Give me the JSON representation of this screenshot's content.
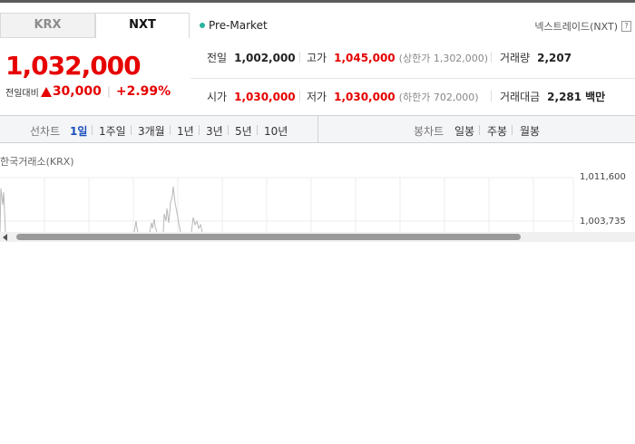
{
  "tabs": [
    {
      "label": "KRX",
      "active": false
    },
    {
      "label": "NXT",
      "active": true
    }
  ],
  "market_status": "Pre-Market",
  "exchange_link": "넥스트레이드(NXT)",
  "help_icon_text": "?",
  "price": {
    "current": "1,032,000",
    "change_label": "전일대비",
    "change_value": "30,000",
    "change_rate": "+2.99%",
    "direction": "up"
  },
  "stats": {
    "prev_close": {
      "label": "전일",
      "value": "1,002,000"
    },
    "high": {
      "label": "고가",
      "value": "1,045,000",
      "sub": "(상한가 1,302,000)"
    },
    "volume": {
      "label": "거래량",
      "value": "2,207"
    },
    "open": {
      "label": "시가",
      "value": "1,030,000"
    },
    "low": {
      "label": "저가",
      "value": "1,030,000",
      "sub": "(하한가 702,000)"
    },
    "amount": {
      "label": "거래대금",
      "value": "2,281",
      "unit": "백만"
    }
  },
  "toolbar": {
    "line_chart_label": "선차트",
    "line_periods": [
      "1일",
      "1주일",
      "3개월",
      "1년",
      "3년",
      "5년",
      "10년"
    ],
    "active_period": "1일",
    "candle_chart_label": "봉차트",
    "candle_periods": [
      "일봉",
      "주봉",
      "월봉"
    ]
  },
  "chart": {
    "title": "한국거래소(KRX)",
    "y_ticks": [
      "1,011,600",
      "1,003,735"
    ]
  },
  "colors": {
    "up": "#e60000",
    "active_period": "#1a4fbf",
    "status_dot": "#2bb3a0"
  }
}
